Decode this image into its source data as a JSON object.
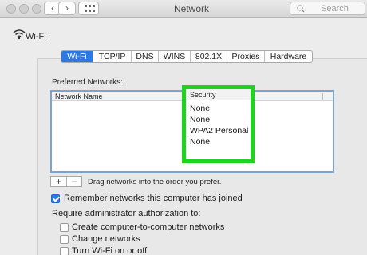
{
  "window": {
    "title": "Network"
  },
  "search": {
    "placeholder": "Search"
  },
  "header": {
    "label": "Wi-Fi"
  },
  "tabs": [
    "Wi-Fi",
    "TCP/IP",
    "DNS",
    "WINS",
    "802.1X",
    "Proxies",
    "Hardware"
  ],
  "active_tab": "Wi-Fi",
  "preferred": {
    "label": "Preferred Networks:",
    "columns": {
      "name": "Network Name",
      "security": "Security"
    },
    "security_values": [
      "None",
      "None",
      "WPA2 Personal",
      "None"
    ]
  },
  "list_controls": {
    "add": "+",
    "remove": "−",
    "hint": "Drag networks into the order you prefer."
  },
  "options": {
    "remember": {
      "label": "Remember networks this computer has joined",
      "checked": true
    },
    "require_label": "Require administrator authorization to:",
    "admin": [
      {
        "label": "Create computer-to-computer networks",
        "checked": false
      },
      {
        "label": "Change networks",
        "checked": false
      },
      {
        "label": "Turn Wi-Fi on or off",
        "checked": false
      }
    ]
  },
  "colors": {
    "accent": "#2b79e2",
    "highlight": "#1fd41f"
  }
}
